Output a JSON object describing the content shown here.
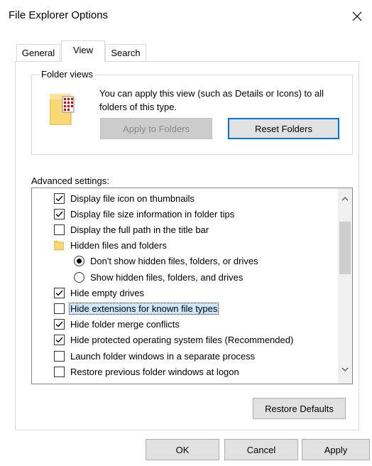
{
  "window": {
    "title": "File Explorer Options"
  },
  "tabs": [
    {
      "label": "General",
      "selected": false
    },
    {
      "label": "View",
      "selected": true
    },
    {
      "label": "Search",
      "selected": false
    }
  ],
  "folder_views": {
    "group_label": "Folder views",
    "description": "You can apply this view (such as Details or Icons) to all folders of this type.",
    "apply_button": "Apply to Folders",
    "reset_button": "Reset Folders"
  },
  "advanced": {
    "label": "Advanced settings:",
    "items": [
      {
        "type": "checkbox",
        "checked": true,
        "label": "Display file icon on thumbnails"
      },
      {
        "type": "checkbox",
        "checked": true,
        "label": "Display file size information in folder tips"
      },
      {
        "type": "checkbox",
        "checked": false,
        "label": "Display the full path in the title bar"
      },
      {
        "type": "folder",
        "label": "Hidden files and folders"
      },
      {
        "type": "radio",
        "checked": true,
        "label": "Don't show hidden files, folders, or drives"
      },
      {
        "type": "radio",
        "checked": false,
        "label": "Show hidden files, folders, and drives"
      },
      {
        "type": "checkbox",
        "checked": true,
        "label": "Hide empty drives"
      },
      {
        "type": "checkbox",
        "checked": false,
        "label": "Hide extensions for known file types",
        "selected": true
      },
      {
        "type": "checkbox",
        "checked": true,
        "label": "Hide folder merge conflicts"
      },
      {
        "type": "checkbox",
        "checked": true,
        "label": "Hide protected operating system files (Recommended)"
      },
      {
        "type": "checkbox",
        "checked": false,
        "label": "Launch folder windows in a separate process"
      },
      {
        "type": "checkbox",
        "checked": false,
        "label": "Restore previous folder windows at logon"
      }
    ]
  },
  "buttons": {
    "restore_defaults": "Restore Defaults",
    "ok": "OK",
    "cancel": "Cancel",
    "apply": "Apply"
  },
  "colors": {
    "accent": "#0078d7",
    "selection": "#cce8ff",
    "folder": "#f8d775"
  }
}
